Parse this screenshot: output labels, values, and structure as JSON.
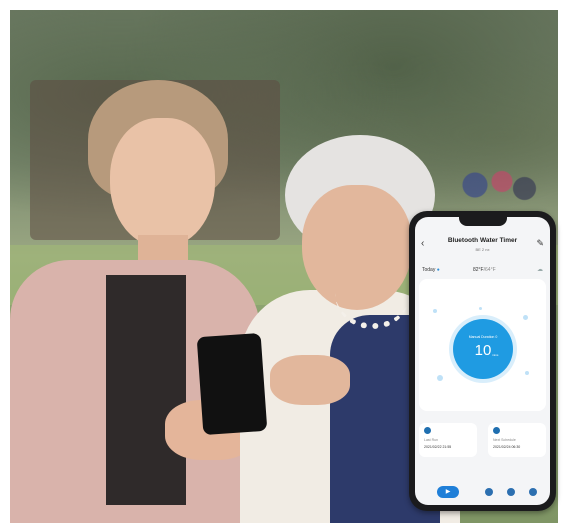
{
  "phone_app": {
    "title": "Bluetooth Water Timer",
    "subtitle": "BE 2 nx",
    "today_label": "Today",
    "temperature": "82°F",
    "temperature_alt": "/64°F",
    "dial_label": "Manual Duration 0",
    "dial_value": "10",
    "dial_unit": "mins",
    "last_run_label": "Last Run",
    "last_run_value": "2021/02/22 21:55",
    "next_schedule_label": "Next Schedule",
    "next_schedule_value": "2021/02/24 06:30"
  },
  "colors": {
    "accent": "#1f9be2",
    "dial_ring": "#d9eefb",
    "phone_frame": "#1b1b1d"
  },
  "icons": [
    "back-icon",
    "edit-icon",
    "water-drop-icon",
    "cloud-icon",
    "play-icon",
    "calendar-icon",
    "timer-icon",
    "settings-icon"
  ]
}
